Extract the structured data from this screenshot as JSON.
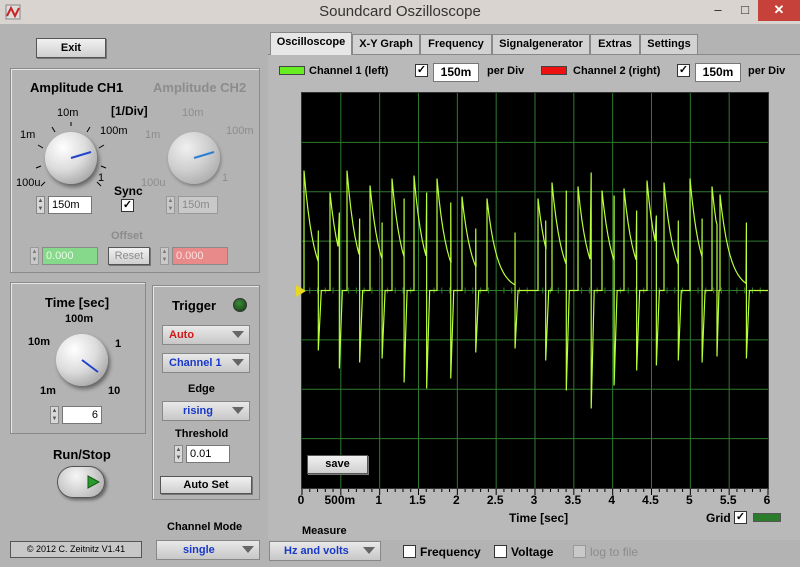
{
  "window": {
    "title": "Soundcard Oszilloscope",
    "min": "–",
    "max": "□",
    "close": "✕"
  },
  "left": {
    "exit_label": "Exit",
    "amp_ch1_title": "Amplitude CH1",
    "amp_ch2_title": "Amplitude CH2",
    "div_unit": "[1/Div]",
    "ch1_scale": [
      "10m",
      "1m",
      "100m",
      "100u",
      "1"
    ],
    "ch2_scale": [
      "10m",
      "1m",
      "100m",
      "100u",
      "1"
    ],
    "sync_label": "Sync",
    "sync_checked": "✓",
    "ch1_value": "150m",
    "ch2_value": "150m",
    "offset_label": "Offset",
    "offset_ch1": "0.000",
    "offset_ch2": "0.000",
    "reset_label": "Reset",
    "time_title": "Time [sec]",
    "time_scale": [
      "100m",
      "10m",
      "1",
      "1m",
      "10"
    ],
    "time_value": "6",
    "runstop_label": "Run/Stop",
    "copyright": "© 2012  C. Zeitnitz V1.41"
  },
  "trigger": {
    "title": "Trigger",
    "mode": "Auto",
    "channel": "Channel 1",
    "edge_label": "Edge",
    "edge": "rising",
    "threshold_label": "Threshold",
    "threshold": "0.01",
    "autoset_label": "Auto Set"
  },
  "channel_mode": {
    "label": "Channel Mode",
    "value": "single"
  },
  "tabs": [
    "Oscilloscope",
    "X-Y Graph",
    "Frequency",
    "Signalgenerator",
    "Extras",
    "Settings"
  ],
  "channels": {
    "ch1_label": "Channel 1 (left)",
    "ch1_check": "✓",
    "ch1_div": "150m",
    "per_div": "per Div",
    "ch2_label": "Channel 2 (right)",
    "ch2_check": "✓",
    "ch2_div": "150m",
    "colors": {
      "ch1": "#66ee22",
      "ch2": "#ee1111",
      "grid": "#2f7a2f",
      "trace": "#b8ff3a"
    }
  },
  "scope": {
    "save_label": "save",
    "x_ticks": [
      "0",
      "500m",
      "1",
      "1.5",
      "2",
      "2.5",
      "3",
      "3.5",
      "4",
      "4.5",
      "5",
      "5.5",
      "6"
    ],
    "x_label": "Time [sec]",
    "grid_label": "Grid",
    "grid_check": "✓"
  },
  "measure": {
    "label": "Measure",
    "mode": "Hz and volts",
    "frequency_label": "Frequency",
    "voltage_label": "Voltage",
    "log_label": "log to file"
  }
}
